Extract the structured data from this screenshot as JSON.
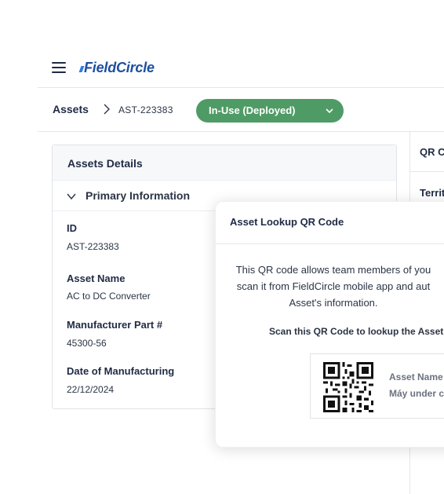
{
  "header": {
    "logo_text": "FieldCircle",
    "brand_color": "#1d4fa0"
  },
  "breadcrumb": {
    "root": "Assets",
    "current": "AST-223383"
  },
  "status": {
    "label": "In-Use (Deployed)",
    "color": "#4f9b66"
  },
  "right_panel": {
    "qr_label": "QR C",
    "territory_label": "Territ"
  },
  "details": {
    "title": "Assets Details",
    "section": "Primary Information",
    "fields": [
      {
        "label": "ID",
        "value": "AST-223383"
      },
      {
        "label": "Asset Name",
        "value": "AC to DC Converter"
      },
      {
        "label": "Manufacturer Part #",
        "value": "45300-56"
      },
      {
        "label": "Date of Manufacturing",
        "value": "22/12/2024"
      }
    ]
  },
  "modal": {
    "title": "Asset Lookup QR Code",
    "description_lines": [
      "This QR code allows team members of you",
      "scan it from FieldCircle mobile app and aut",
      "Asset's information."
    ],
    "scan_text": "Scan this QR Code to lookup the Asset",
    "qr_name_label": "Asset Name",
    "qr_name_value": "Máy under c"
  }
}
